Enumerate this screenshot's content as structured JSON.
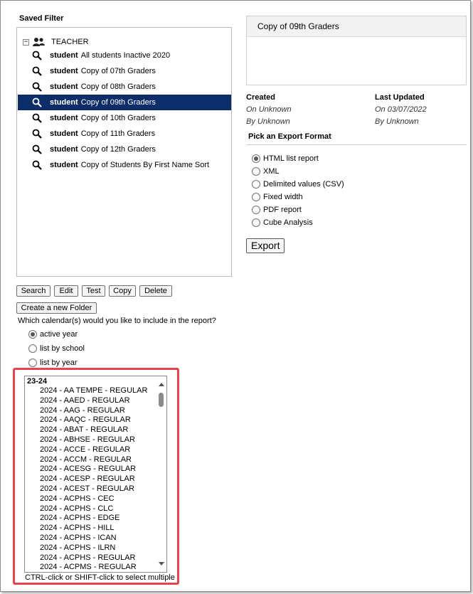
{
  "saved_filter": {
    "title": "Saved Filter",
    "folder": "TEACHER",
    "items": [
      {
        "type": "student",
        "name": "All students Inactive 2020"
      },
      {
        "type": "student",
        "name": "Copy of 07th Graders"
      },
      {
        "type": "student",
        "name": "Copy of 08th Graders"
      },
      {
        "type": "student",
        "name": "Copy of 09th Graders",
        "selected": true
      },
      {
        "type": "student",
        "name": "Copy of 10th Graders"
      },
      {
        "type": "student",
        "name": "Copy of 11th Graders"
      },
      {
        "type": "student",
        "name": "Copy of 12th Graders"
      },
      {
        "type": "student",
        "name": "Copy of Students By First Name Sort"
      }
    ]
  },
  "buttons": {
    "search": "Search",
    "edit": "Edit",
    "test": "Test",
    "copy": "Copy",
    "delete": "Delete",
    "new_folder": "Create a new Folder"
  },
  "calendar": {
    "question": "Which calendar(s) would you like to include in the report?",
    "options": [
      "active year",
      "list by school",
      "list by year"
    ],
    "selected": "active year",
    "list_group": "23-24",
    "list_items": [
      "2024 - AA TEMPE - REGULAR",
      "2024 - AAED - REGULAR",
      "2024 - AAG - REGULAR",
      "2024 - AAQC - REGULAR",
      "2024 - ABAT - REGULAR",
      "2024 - ABHSE - REGULAR",
      "2024 - ACCE - REGULAR",
      "2024 - ACCM - REGULAR",
      "2024 - ACESG - REGULAR",
      "2024 - ACESP - REGULAR",
      "2024 - ACEST - REGULAR",
      "2024 - ACPHS - CEC",
      "2024 - ACPHS - CLC",
      "2024 - ACPHS - EDGE",
      "2024 - ACPHS - HILL",
      "2024 - ACPHS - ICAN",
      "2024 - ACPHS - ILRN",
      "2024 - ACPHS - REGULAR",
      "2024 - ACPMS - REGULAR"
    ],
    "hint": "CTRL-click or SHIFT-click to select multiple"
  },
  "detail": {
    "title": "Copy of 09th Graders",
    "created_label": "Created",
    "created_on": "On Unknown",
    "created_by": "By Unknown",
    "updated_label": "Last Updated",
    "updated_on": "On 03/07/2022",
    "updated_by": "By Unknown"
  },
  "export": {
    "heading": "Pick an Export Format",
    "formats": [
      "HTML list report",
      "XML",
      "Delimited values (CSV)",
      "Fixed width",
      "PDF report",
      "Cube Analysis"
    ],
    "selected": "HTML list report",
    "button": "Export"
  }
}
